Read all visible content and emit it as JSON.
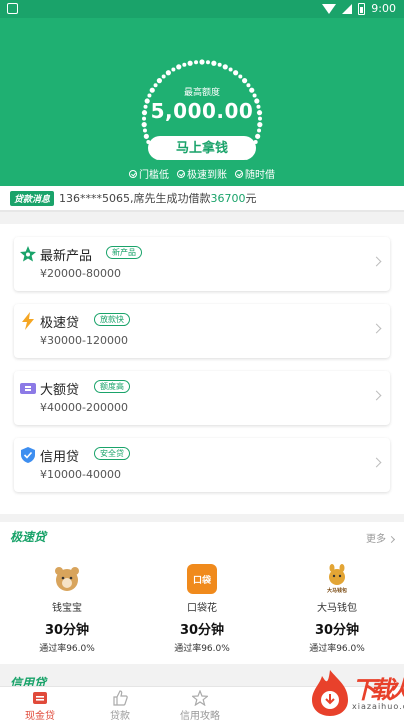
{
  "status": {
    "time": "9:00"
  },
  "hero": {
    "dial_label": "最高额度",
    "amount": "5,000.00",
    "cta": "马上拿钱",
    "features": [
      "门槛低",
      "极速到账",
      "随时借"
    ]
  },
  "ticker": {
    "badge": "贷款消息",
    "text": "136****5065,席先生成功借款",
    "amount": "36700",
    "suffix": "元"
  },
  "products": [
    {
      "name": "最新产品",
      "tag": "新产品",
      "range": "¥20000-80000",
      "icon": "star-badge-icon",
      "color": "#1aa36a"
    },
    {
      "name": "极速贷",
      "tag": "放款快",
      "range": "¥30000-120000",
      "icon": "lightning-icon",
      "color": "#f5a623"
    },
    {
      "name": "大额贷",
      "tag": "额度高",
      "range": "¥40000-200000",
      "icon": "ticket-icon",
      "color": "#8c7ae6"
    },
    {
      "name": "信用贷",
      "tag": "安全贷",
      "range": "¥10000-40000",
      "icon": "shield-check-icon",
      "color": "#3d8ef0"
    }
  ],
  "fast_section": {
    "title": "极速贷",
    "more": "更多",
    "apps": [
      {
        "name": "钱宝宝",
        "time": "30分钟",
        "rate": "通过率96.0%",
        "logo_text": "",
        "icon": "bear-logo-icon"
      },
      {
        "name": "口袋花",
        "time": "30分钟",
        "rate": "通过率96.0%",
        "logo_text": "口袋",
        "icon": "pocket-logo-icon"
      },
      {
        "name": "大马钱包",
        "time": "30分钟",
        "rate": "通过率96.0%",
        "logo_text": "大马钱包",
        "icon": "horse-logo-icon"
      }
    ]
  },
  "credit_section": {
    "title": "信用贷"
  },
  "tabs": [
    {
      "label": "现金贷",
      "icon": "cash-loan-icon",
      "active": true
    },
    {
      "label": "贷款",
      "icon": "thumb-up-icon",
      "active": false
    },
    {
      "label": "信用攻略",
      "icon": "star-outline-icon",
      "active": false
    }
  ],
  "watermark": {
    "text": "下载火",
    "url": "xiazaihuo.com"
  },
  "colors": {
    "primary": "#1aa36a",
    "hero_bg": "#1fb072",
    "active_tab": "#e04a3a"
  }
}
